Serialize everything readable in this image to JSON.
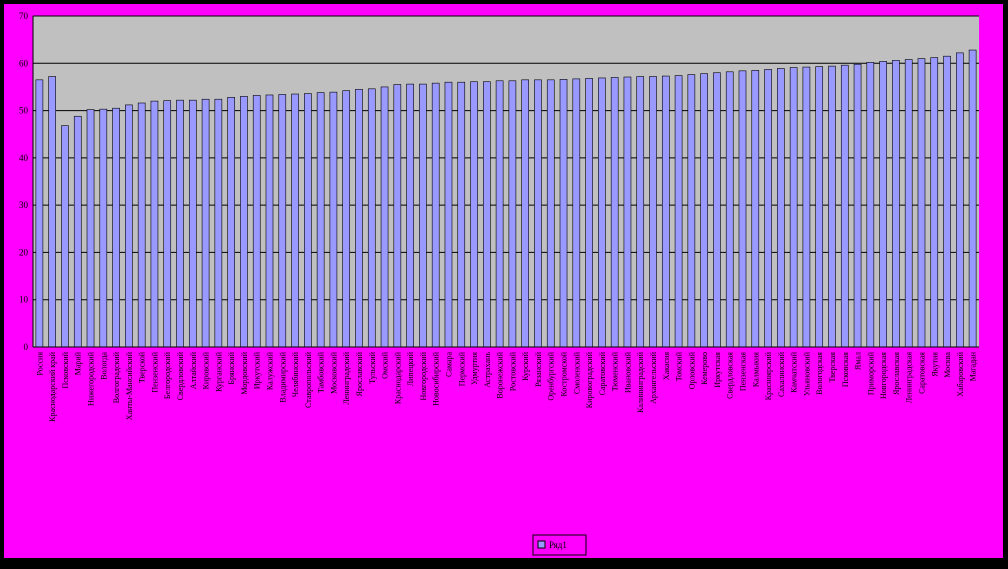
{
  "colors": {
    "outer_border": "#000000",
    "chart_area": "#ff00ff",
    "plot_area": "#c0c0c0",
    "bar_fill": "#9999ff",
    "bar_stroke": "#000000",
    "gridline": "#000000",
    "text": "#000000"
  },
  "chart_data": {
    "type": "bar",
    "title": "",
    "xlabel": "",
    "ylabel": "",
    "ylim": [
      0,
      70
    ],
    "yticks": [
      0,
      10,
      20,
      30,
      40,
      50,
      60,
      70
    ],
    "grid": true,
    "legend_position": "bottom",
    "categories": [
      "Россия",
      "Краснодарский край",
      "Псковский",
      "Марий",
      "Нижегородский",
      "Вологда",
      "Волгоградский",
      "Ханты-Мансийский",
      "Тверской",
      "Пензенский",
      "Белгородский",
      "Свердловский",
      "Алтайский",
      "Кировский",
      "Курганский",
      "Брянский",
      "Мордовский",
      "Иркутский",
      "Калужский",
      "Владимирский",
      "Челябинский",
      "Ставропольский",
      "Тамбовский",
      "Московский",
      "Ленинградский",
      "Ярославский",
      "Тульский",
      "Омский",
      "Краснодарский",
      "Липецкий",
      "Новгородский",
      "Новосибирский",
      "Самара",
      "Пермский",
      "Удмуртия",
      "Астрахань",
      "Воронежский",
      "Ростовский",
      "Курский",
      "Рязанский",
      "Оренбургский",
      "Костромской",
      "Смоленский",
      "Кировоградский",
      "Саратовский",
      "Тюменский",
      "Ивановский",
      "Калининградский",
      "Архангельский",
      "Хакасия",
      "Томский",
      "Орловский",
      "Кемерово",
      "Иркутская",
      "Свердловская",
      "Пензенская",
      "Калмыкия",
      "Красноярский",
      "Сахалинский",
      "Камчатский",
      "Ульяновский",
      "Вологодская",
      "Тверская",
      "Псковская",
      "Ямал",
      "Приморский",
      "Новгородская",
      "Ярославская",
      "Ленинградская",
      "Саратовская",
      "Якутия",
      "Москва",
      "Хабаровский",
      "Магадан"
    ],
    "series": [
      {
        "name": "Ряд1",
        "values": [
          56.5,
          57.2,
          46.8,
          48.8,
          50.2,
          50.3,
          50.5,
          51.2,
          51.6,
          52.0,
          52.1,
          52.2,
          52.2,
          52.4,
          52.4,
          52.8,
          53.0,
          53.2,
          53.3,
          53.4,
          53.5,
          53.6,
          53.8,
          53.9,
          54.2,
          54.5,
          54.6,
          55.0,
          55.5,
          55.6,
          55.6,
          55.8,
          56.0,
          56.0,
          56.1,
          56.1,
          56.3,
          56.3,
          56.5,
          56.5,
          56.5,
          56.6,
          56.7,
          56.8,
          56.9,
          57.0,
          57.1,
          57.2,
          57.2,
          57.3,
          57.4,
          57.6,
          57.8,
          58.0,
          58.2,
          58.4,
          58.5,
          58.7,
          58.9,
          59.1,
          59.2,
          59.3,
          59.4,
          59.6,
          59.8,
          60.2,
          60.4,
          60.6,
          60.8,
          61.0,
          61.2,
          61.5,
          62.2,
          62.8
        ]
      }
    ]
  }
}
